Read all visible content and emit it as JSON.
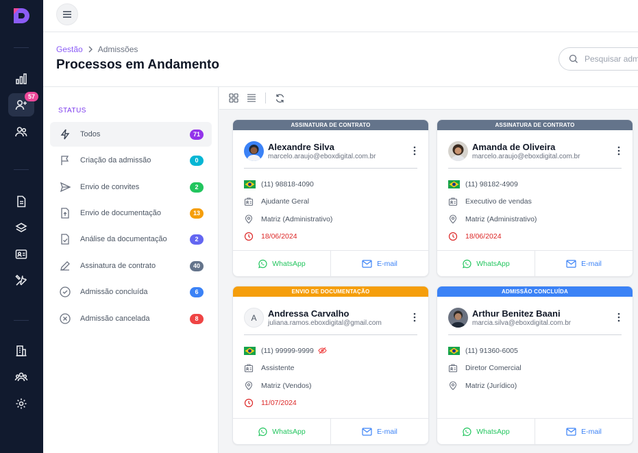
{
  "sidebar": {
    "badge_count": "57",
    "icons": [
      "logo-icon",
      "chart-bar-icon",
      "user-add-icon",
      "users-icon",
      "document-icon",
      "layers-icon",
      "id-card-icon",
      "tools-icon",
      "building-icon",
      "team-icon",
      "gear-icon"
    ]
  },
  "breadcrumb": {
    "parent": "Gestão",
    "current": "Admissões"
  },
  "page": {
    "title": "Processos em Andamento"
  },
  "search": {
    "placeholder": "Pesquisar admissão"
  },
  "status_panel": {
    "title": "STATUS",
    "items": [
      {
        "label": "Todos",
        "count": "71",
        "color": "#9333ea"
      },
      {
        "label": "Criação da admissão",
        "count": "0",
        "color": "#06b6d4"
      },
      {
        "label": "Envio de convites",
        "count": "2",
        "color": "#22c55e"
      },
      {
        "label": "Envio de documentação",
        "count": "13",
        "color": "#f59e0b"
      },
      {
        "label": "Análise da documentação",
        "count": "2",
        "color": "#6366f1"
      },
      {
        "label": "Assinatura de contrato",
        "count": "40",
        "color": "#64748b"
      },
      {
        "label": "Admissão concluída",
        "count": "6",
        "color": "#3b82f6"
      },
      {
        "label": "Admissão cancelada",
        "count": "8",
        "color": "#ef4444"
      }
    ]
  },
  "cards": [
    {
      "status": "ASSINATURA DE CONTRATO",
      "status_color": "#64748b",
      "name": "Alexandre Silva",
      "email": "marcelo.araujo@eboxdigital.com.br",
      "phone": "(11) 98818-4090",
      "role": "Ajudante Geral",
      "location": "Matriz (Administrativo)",
      "date": "18/06/2024",
      "whatsapp": "WhatsApp",
      "email_btn": "E-mail"
    },
    {
      "status": "ASSINATURA DE CONTRATO",
      "status_color": "#64748b",
      "name": "Amanda de Oliveira",
      "email": "marcelo.araujo@eboxdigital.com.br",
      "phone": "(11) 98182-4909",
      "role": "Executivo de vendas",
      "location": "Matriz (Administrativo)",
      "date": "18/06/2024",
      "whatsapp": "WhatsApp",
      "email_btn": "E-mail"
    },
    {
      "status": "ENVIO DE DOCUMENTAÇÃO",
      "status_color": "#f59e0b",
      "name": "Andressa Carvalho",
      "email": "juliana.ramos.eboxdigital@gmail.com",
      "avatar_letter": "A",
      "phone": "(11) 99999-9999",
      "role": "Assistente",
      "location": "Matriz (Vendos)",
      "date": "11/07/2024",
      "whatsapp": "WhatsApp",
      "email_btn": "E-mail"
    },
    {
      "status": "ADMISSÃO CONCLUÍDA",
      "status_color": "#3b82f6",
      "name": "Arthur Benitez Baani",
      "email": "marcia.silva@eboxdigital.com.br",
      "phone": "(11) 91360-6005",
      "role": "Diretor Comercial",
      "location": "Matriz (Jurídico)",
      "whatsapp": "WhatsApp",
      "email_btn": "E-mail"
    }
  ]
}
